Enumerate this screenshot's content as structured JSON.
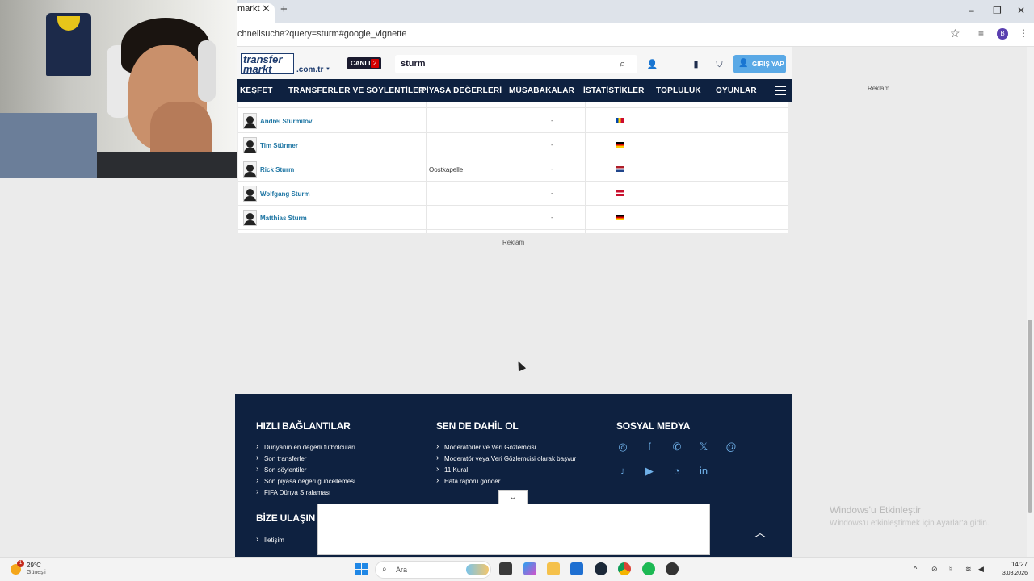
{
  "browser": {
    "tab_title": "markt",
    "tab_close": "✕",
    "new_tab": "+",
    "url": "chnellsuche?query=sturm#google_vignette",
    "profile_initial": "B",
    "window_controls": [
      "–",
      "❐",
      "✕"
    ]
  },
  "header": {
    "logo_line1": "transfer",
    "logo_line2": "markt",
    "logo_domain": ".com.tr",
    "live_label": "CANLI",
    "live_count": "2",
    "search_value": "sturm",
    "login_label": "GİRİŞ YAP"
  },
  "nav": {
    "items": [
      "KEŞFET",
      "TRANSFERLER VE SÖYLENTİLER",
      "PİYASA DEĞERLERİ",
      "MÜSABAKALAR",
      "İSTATİSTİKLER",
      "TOPLULUK",
      "OYUNLAR"
    ]
  },
  "ad_label": "Reklam",
  "players": [
    {
      "name": "Andrei Sturmilov",
      "club": "",
      "value": "-",
      "flag": "moldova"
    },
    {
      "name": "Tim Stürmer",
      "club": "",
      "value": "-",
      "flag": "germany"
    },
    {
      "name": "Rick Sturm",
      "club": "Oostkapelle",
      "value": "-",
      "flag": "netherlands"
    },
    {
      "name": "Wolfgang Sturm",
      "club": "",
      "value": "-",
      "flag": "austria"
    },
    {
      "name": "Matthias Sturm",
      "club": "",
      "value": "-",
      "flag": "germany"
    }
  ],
  "footer": {
    "quick_links_title": "HIZLI BAĞLANTILAR",
    "quick_links": [
      "Dünyanın en değerli futbolcuları",
      "Son transferler",
      "Son söylentiler",
      "Son piyasa değeri güncellemesi",
      "FIFA Dünya Sıralaması"
    ],
    "join_title": "SEN DE DAHİL OL",
    "join_links": [
      "Moderatörler ve Veri Gözlemcisi",
      "Moderatör veya Veri Gözlemcisi olarak başvur",
      "11 Kural",
      "Hata raporu gönder"
    ],
    "social_title": "SOSYAL MEDYA",
    "contact_title": "BİZE ULAŞIN",
    "contact_links": [
      "İletişim"
    ]
  },
  "windows_activation": {
    "title": "Windows'u Etkinleştir",
    "subtitle": "Windows'u etkinleştirmek için Ayarlar'a gidin."
  },
  "taskbar": {
    "temperature": "29°C",
    "condition": "Güneşli",
    "weather_badge": "1",
    "search_placeholder": "Ara",
    "time": "14:27",
    "date": "3.08.2026"
  }
}
